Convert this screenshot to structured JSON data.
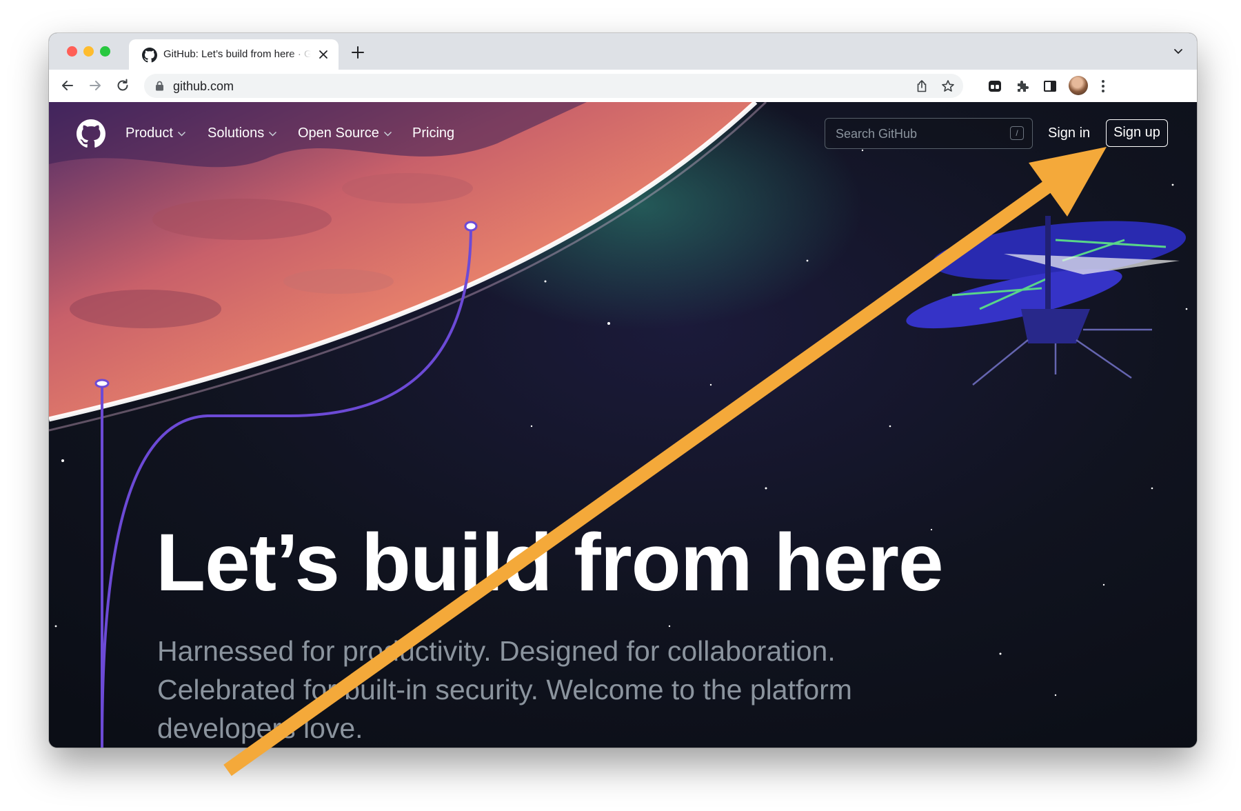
{
  "browser": {
    "tab": {
      "title": "GitHub: Let’s build from here · GitHub",
      "favicon": "github-icon"
    },
    "url": "github.com",
    "chrome_colors": {
      "tabbar": "#dee1e6",
      "toolbar": "#ffffff",
      "omnibox": "#f1f3f4"
    },
    "icons": [
      "back-icon",
      "forward-icon",
      "reload-icon",
      "lock-icon",
      "share-icon",
      "star-icon",
      "extension-icon",
      "puzzle-icon",
      "side-panel-icon",
      "more-icon"
    ]
  },
  "github": {
    "nav": {
      "items": [
        {
          "label": "Product",
          "dropdown": true
        },
        {
          "label": "Solutions",
          "dropdown": true
        },
        {
          "label": "Open Source",
          "dropdown": true
        },
        {
          "label": "Pricing",
          "dropdown": false
        }
      ],
      "search_placeholder": "Search GitHub",
      "search_shortcut": "/",
      "sign_in": "Sign in",
      "sign_up": "Sign up"
    },
    "hero": {
      "title": "Let’s build from here",
      "subtitle": "Harnessed for productivity. Designed for collaboration. Celebrated for built-in security. Welcome to the platform developers love."
    },
    "colors": {
      "background": "#0d1117",
      "text": "#ffffff",
      "muted": "#8b949e",
      "planet": "#e07a63",
      "path": "#7c4dff"
    }
  },
  "annotation": {
    "type": "arrow",
    "points_to": "sign-up-button",
    "color": "#f4a93a"
  }
}
